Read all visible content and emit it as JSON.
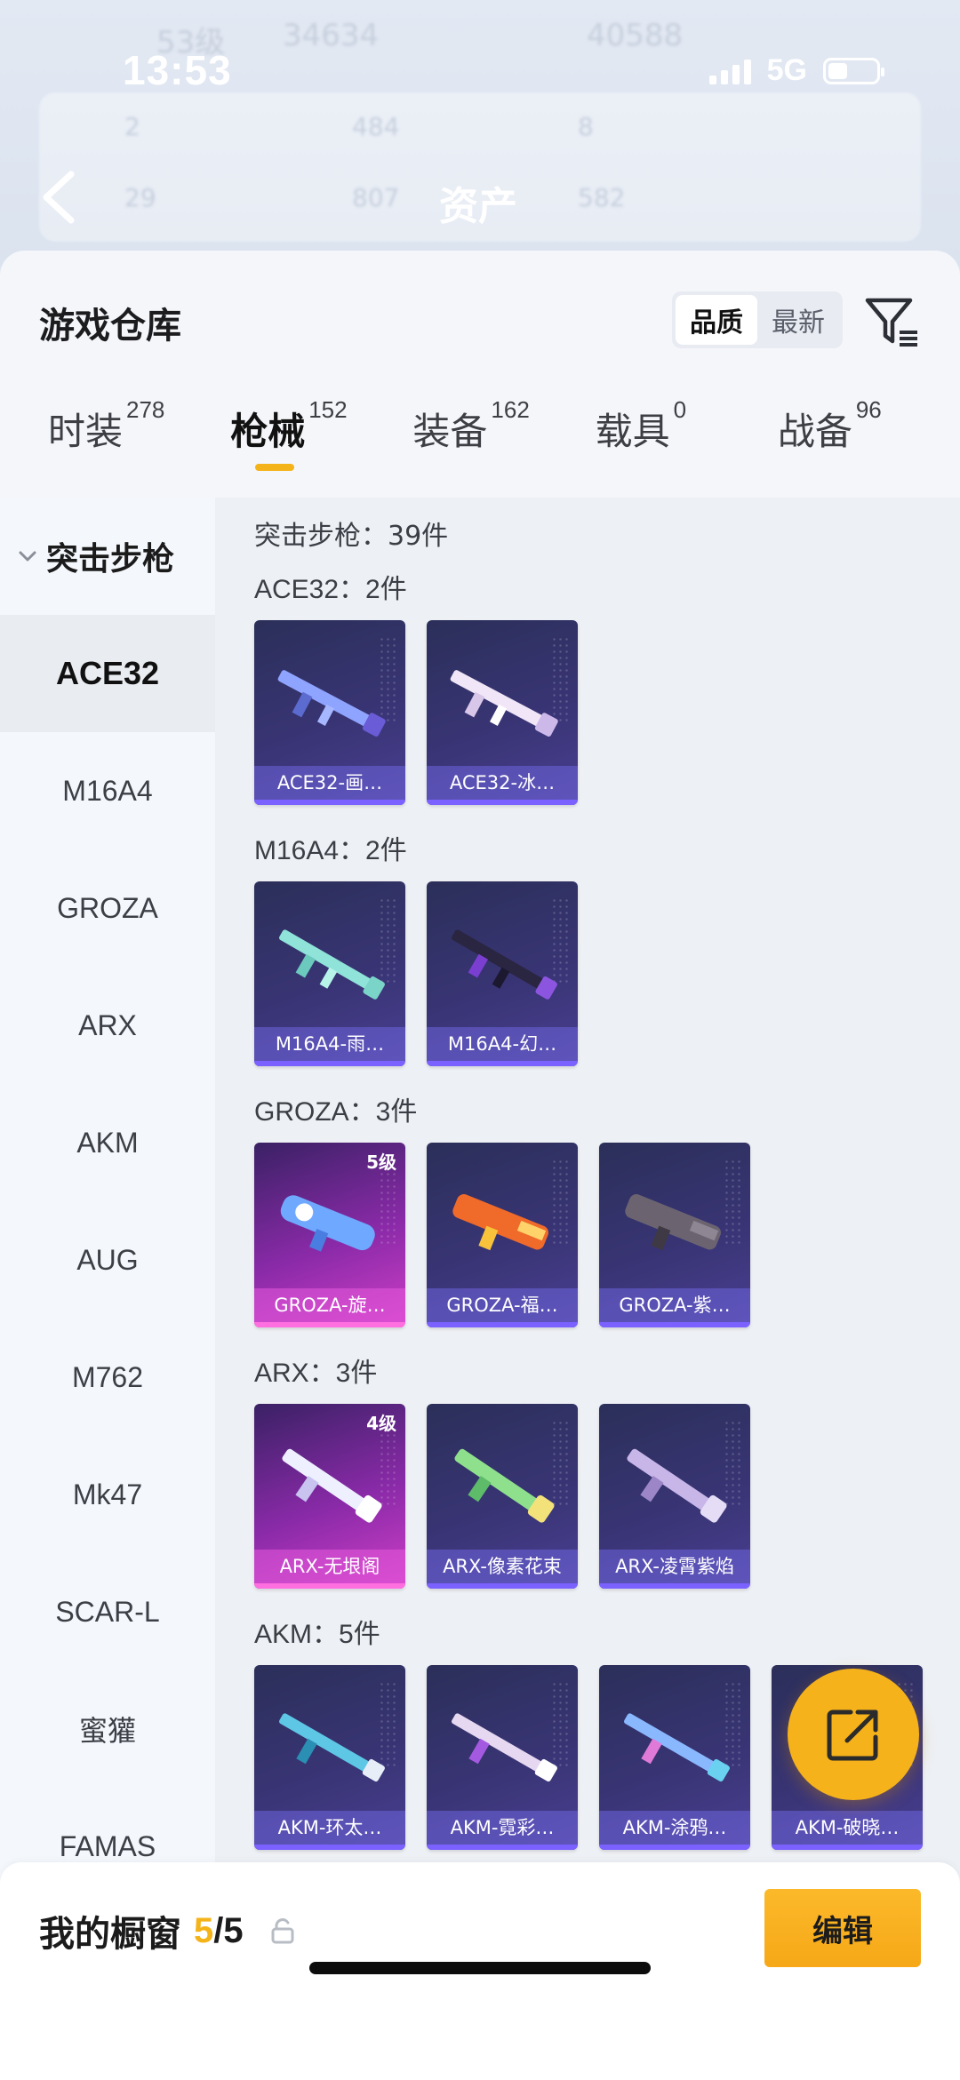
{
  "status": {
    "time": "13:53",
    "network": "5G"
  },
  "background": {
    "title": "资产",
    "ghost_texts": [
      "53级",
      "34634",
      "40588",
      "2",
      "484",
      "8",
      "29",
      "807",
      "582"
    ]
  },
  "sheet": {
    "title": "游戏仓库",
    "sort_options": [
      "品质",
      "最新"
    ],
    "tabs": [
      {
        "label": "时装",
        "count": "278"
      },
      {
        "label": "枪械",
        "count": "152"
      },
      {
        "label": "装备",
        "count": "162"
      },
      {
        "label": "载具",
        "count": "0"
      },
      {
        "label": "战备",
        "count": "96"
      }
    ]
  },
  "sidebar": {
    "category": "突击步枪",
    "items": [
      "ACE32",
      "M16A4",
      "GROZA",
      "ARX",
      "AKM",
      "AUG",
      "M762",
      "Mk47",
      "SCAR-L",
      "蜜獾",
      "FAMAS"
    ]
  },
  "content": {
    "total_label": "突击步枪：39件",
    "groups": [
      {
        "label": "ACE32：2件",
        "items": [
          {
            "name": "ACE32-画…",
            "level": ""
          },
          {
            "name": "ACE32-冰…",
            "level": ""
          }
        ]
      },
      {
        "label": "M16A4：2件",
        "items": [
          {
            "name": "M16A4-雨…",
            "level": ""
          },
          {
            "name": "M16A4-幻…",
            "level": ""
          }
        ]
      },
      {
        "label": "GROZA：3件",
        "items": [
          {
            "name": "GROZA-旋…",
            "level": "5级"
          },
          {
            "name": "GROZA-福…",
            "level": ""
          },
          {
            "name": "GROZA-紫…",
            "level": ""
          }
        ]
      },
      {
        "label": "ARX：3件",
        "items": [
          {
            "name": "ARX-无垠阁",
            "level": "4级"
          },
          {
            "name": "ARX-像素花束",
            "level": ""
          },
          {
            "name": "ARX-凌霄紫焰",
            "level": ""
          }
        ]
      },
      {
        "label": "AKM：5件",
        "items": [
          {
            "name": "AKM-环太…",
            "level": ""
          },
          {
            "name": "AKM-霓彩…",
            "level": ""
          },
          {
            "name": "AKM-涂鸦…",
            "level": ""
          },
          {
            "name": "AKM-破晓…",
            "level": ""
          }
        ]
      }
    ]
  },
  "bottom": {
    "showcase_label": "我的橱窗",
    "showcase_current": "5",
    "showcase_total": "/5",
    "edit_label": "编辑"
  },
  "colors": {
    "accent": "#f5b31a",
    "card_blue": "#3a3577",
    "card_pink": "#cf3fc6"
  }
}
